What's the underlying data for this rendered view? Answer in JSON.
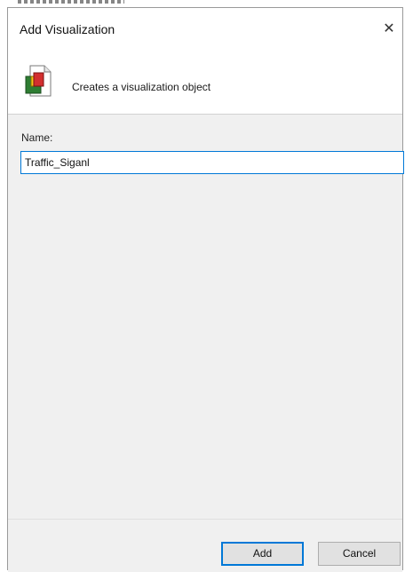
{
  "dialog": {
    "title": "Add Visualization",
    "close_glyph": "✕",
    "description": "Creates a visualization object",
    "icon": "visualization-object-icon"
  },
  "form": {
    "name_label": "Name:",
    "name_value": "Traffic_Siganl"
  },
  "buttons": {
    "add_label": "Add",
    "cancel_label": "Cancel"
  },
  "colors": {
    "focus_border": "#0078d7",
    "panel_bg": "#f0f0f0",
    "button_bg": "#e1e1e1"
  }
}
